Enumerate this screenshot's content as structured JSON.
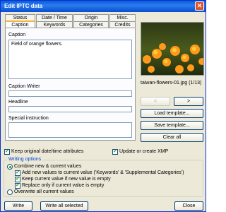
{
  "window": {
    "title": "Edit IPTC data",
    "close_symbol": "✕"
  },
  "tabs_back": [
    "Status",
    "Date / Time",
    "Origin",
    "Misc."
  ],
  "tabs_front": [
    "Caption",
    "Keywords",
    "Categories",
    "Credits"
  ],
  "caption": {
    "caption_label": "Caption",
    "caption_value": "Field of orange flowers.",
    "writer_label": "Caption Writer",
    "writer_value": "",
    "headline_label": "Headline",
    "headline_value": "",
    "special_label": "Special instruction",
    "special_value": ""
  },
  "preview": {
    "filename": "taiwan-flowers-01.jpg (1/13)",
    "prev_symbol": "<",
    "next_symbol": ">"
  },
  "buttons": {
    "load_template": "Load template...",
    "save_template": "Save template...",
    "clear_all": "Clear all",
    "write": "Write",
    "write_all": "Write all selected",
    "close": "Close"
  },
  "options": {
    "keep_original": "Keep original date/time attributes",
    "update_xmp": "Update or create XMP",
    "writing_title": "Writing options",
    "combine": "Combine new & current values",
    "add_new": "Add new values to current value ('Keywords' & 'Supplemental Categories')",
    "keep_current": "Keep current value if new value is empty",
    "replace_only": "Replace only if current value is empty",
    "overwrite": "Overwrite all current values",
    "check_symbol": "✔"
  },
  "colors": {
    "titlebar": "#0a5bd6",
    "accent_tab": "#f5b43d",
    "check": "#21a121"
  }
}
